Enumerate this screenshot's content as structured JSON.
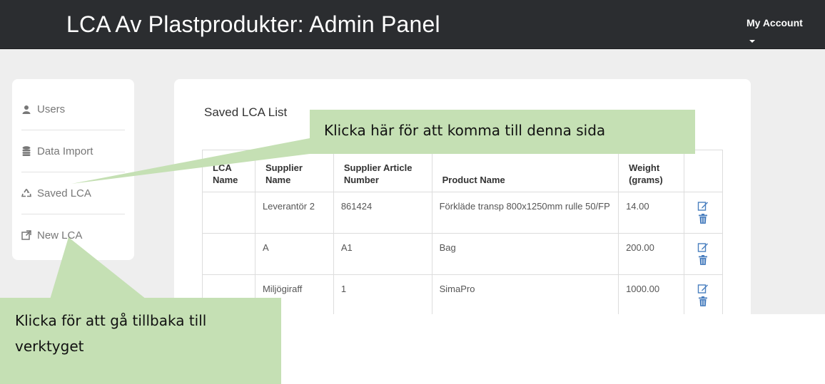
{
  "header": {
    "title": "LCA Av Plastprodukter: Admin Panel",
    "account_label": "My Account"
  },
  "sidebar": {
    "items": [
      {
        "label": "Users",
        "icon": "user-icon"
      },
      {
        "label": "Data Import",
        "icon": "database-icon"
      },
      {
        "label": "Saved LCA",
        "icon": "recycle-icon"
      },
      {
        "label": "New LCA",
        "icon": "external-link-icon"
      }
    ]
  },
  "main": {
    "title": "Saved LCA List",
    "table": {
      "columns": [
        "LCA Name",
        "Supplier Name",
        "Supplier Article Number",
        "Product Name",
        "Weight (grams)",
        ""
      ],
      "rows": [
        {
          "lca_name": "",
          "supplier_name": "Leverantör 2",
          "article_number": "861424",
          "product_name": "Förkläde transp 800x1250mm rulle 50/FP",
          "weight": "14.00"
        },
        {
          "lca_name": "",
          "supplier_name": "A",
          "article_number": "A1",
          "product_name": "Bag",
          "weight": "200.00"
        },
        {
          "lca_name": "",
          "supplier_name": "Miljögiraff",
          "article_number": "1",
          "product_name": "SimaPro",
          "weight": "1000.00"
        }
      ]
    }
  },
  "callouts": {
    "top": "Klicka här för att komma till denna sida",
    "bottom": "Klicka för att gå tillbaka till verktyget"
  },
  "colors": {
    "navbar": "#2b2d30",
    "background": "#eeeeee",
    "callout": "#c5e0b4",
    "action_icon": "#4a7fbf"
  }
}
